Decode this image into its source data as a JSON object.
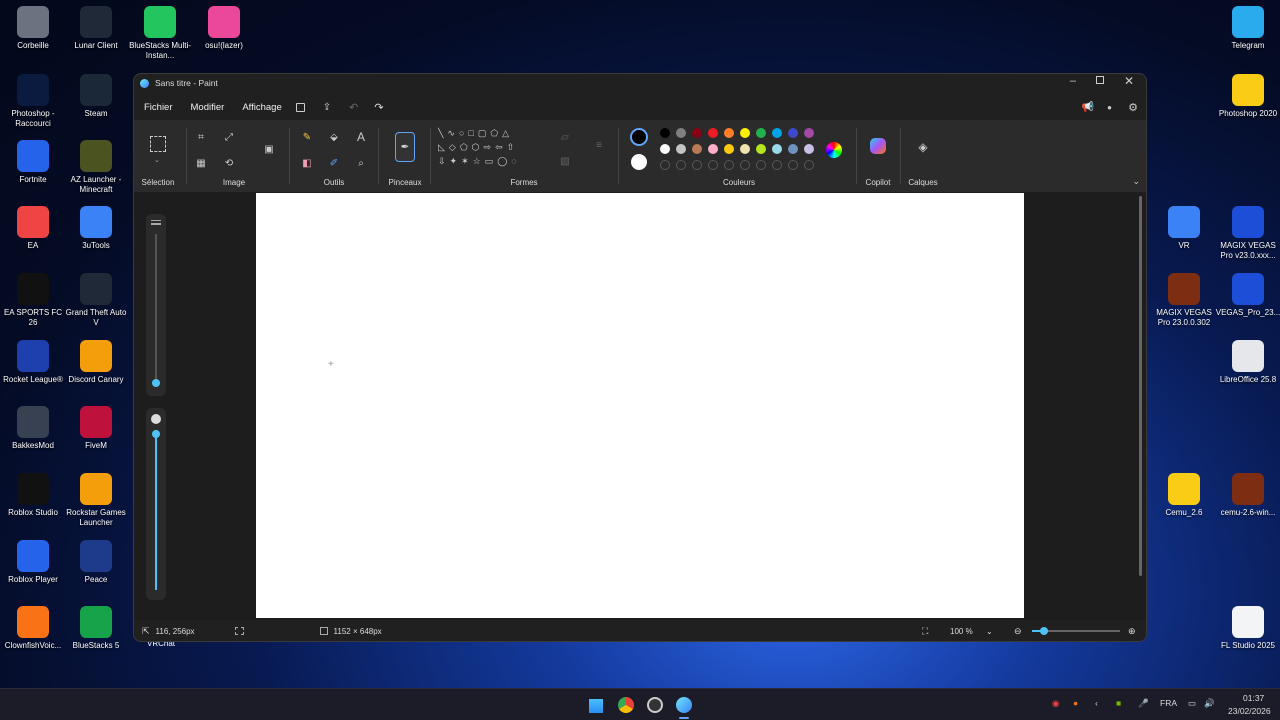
{
  "desktop": {
    "left_icons": [
      {
        "label": "Corbeille",
        "icon": "recycle-bin-icon",
        "color": "#6b7280"
      },
      {
        "label": "Lunar Client",
        "icon": "lunar-client-icon",
        "color": "#1f2937"
      },
      {
        "label": "BlueStacks Multi-Instan...",
        "icon": "bluestacks-icon",
        "color": "#22c55e"
      },
      {
        "label": "osu!(lazer)",
        "icon": "osu-icon",
        "color": "#ec4899"
      },
      {
        "label": "Photoshop - Raccourci",
        "icon": "photoshop-icon",
        "color": "#0b1b3f"
      },
      {
        "label": "Steam",
        "icon": "steam-icon",
        "color": "#1b2838"
      },
      {
        "label": "Fortnite",
        "icon": "fortnite-icon",
        "color": "#2563eb"
      },
      {
        "label": "AZ Launcher - Minecraft",
        "icon": "az-launcher-icon",
        "color": "#4b5320"
      },
      {
        "label": "EA",
        "icon": "ea-icon",
        "color": "#ef4444"
      },
      {
        "label": "3uTools",
        "icon": "3utools-icon",
        "color": "#3b82f6"
      },
      {
        "label": "EA SPORTS FC 26",
        "icon": "fc26-icon",
        "color": "#111111"
      },
      {
        "label": "Grand Theft Auto V",
        "icon": "gta-icon",
        "color": "#1f2937"
      },
      {
        "label": "Rocket League®",
        "icon": "rocket-league-icon",
        "color": "#1e40af"
      },
      {
        "label": "Discord Canary",
        "icon": "discord-icon",
        "color": "#f59e0b"
      },
      {
        "label": "BakkesMod",
        "icon": "bakkesmod-icon",
        "color": "#374151"
      },
      {
        "label": "FiveM",
        "icon": "fivem-icon",
        "color": "#be123c"
      },
      {
        "label": "Roblox Studio",
        "icon": "roblox-studio-icon",
        "color": "#111111"
      },
      {
        "label": "Rockstar Games Launcher",
        "icon": "rockstar-icon",
        "color": "#f59e0b"
      },
      {
        "label": "Roblox Player",
        "icon": "roblox-player-icon",
        "color": "#2563eb"
      },
      {
        "label": "Peace",
        "icon": "peace-icon",
        "color": "#1e3a8a"
      },
      {
        "label": "ClownfishVoic...",
        "icon": "clownfish-icon",
        "color": "#f97316"
      },
      {
        "label": "BlueStacks 5",
        "icon": "bluestacks5-icon",
        "color": "#16a34a"
      }
    ],
    "right_icons": [
      {
        "label": "Telegram",
        "icon": "telegram-icon",
        "color": "#2aabee"
      },
      {
        "label": "Photoshop 2020",
        "icon": "folder-icon",
        "color": "#facc15"
      },
      {
        "label": "VR",
        "icon": "vr-icon",
        "color": "#3b82f6"
      },
      {
        "label": "MAGIX VEGAS Pro v23.0.xxx...",
        "icon": "vegas-icon",
        "color": "#1d4ed8"
      },
      {
        "label": "MAGIX VEGAS Pro 23.0.0.302",
        "icon": "winrar-icon",
        "color": "#7c2d12"
      },
      {
        "label": "VEGAS_Pro_23...",
        "icon": "vegas-icon",
        "color": "#1d4ed8"
      },
      {
        "label": "LibreOffice 25.8",
        "icon": "document-icon",
        "color": "#e5e7eb"
      },
      {
        "label": "Cemu_2.6",
        "icon": "folder-icon",
        "color": "#facc15"
      },
      {
        "label": "cemu-2.6-win...",
        "icon": "winrar-icon",
        "color": "#7c2d12"
      },
      {
        "label": "FL Studio 2025",
        "icon": "document-icon",
        "color": "#f3f4f6"
      }
    ],
    "hidden_label": "VRChat"
  },
  "paint": {
    "title": "Sans titre - Paint",
    "menu": [
      "Fichier",
      "Modifier",
      "Affichage"
    ],
    "groups": {
      "selection": "Sélection",
      "image": "Image",
      "tools": "Outils",
      "brushes": "Pinceaux",
      "shapes": "Formes",
      "colors": "Couleurs",
      "copilot": "Copilot",
      "layers": "Calques"
    },
    "palette_row1": [
      "#000000",
      "#7f7f7f",
      "#880015",
      "#ed1c24",
      "#ff7f27",
      "#fff200",
      "#22b14c",
      "#00a2e8",
      "#3f48cc",
      "#a349a4"
    ],
    "palette_row2": [
      "#ffffff",
      "#c3c3c3",
      "#b97a57",
      "#ffaec9",
      "#ffc90e",
      "#efe4b0",
      "#b5e61d",
      "#99d9ea",
      "#7092be",
      "#c8bfe7"
    ],
    "status": {
      "cursor": "116, 256px",
      "size": "1152 × 648px",
      "zoom": "100 %"
    }
  },
  "taskbar": {
    "lang": "FRA",
    "time": "01:37",
    "date": "23/02/2026"
  }
}
